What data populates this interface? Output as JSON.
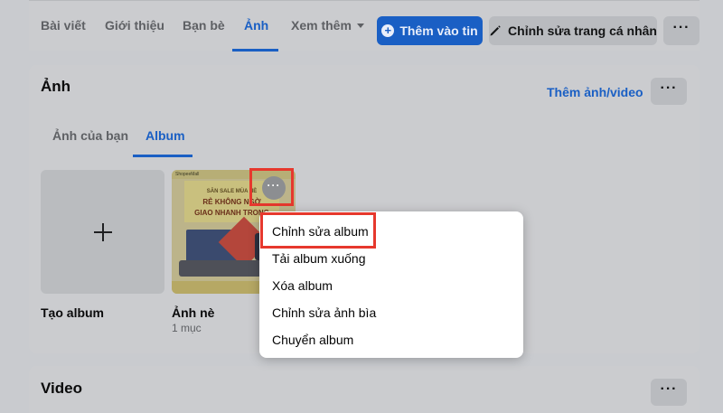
{
  "nav": {
    "tabs": [
      "Bài viết",
      "Giới thiệu",
      "Bạn bè",
      "Ảnh",
      "Xem thêm"
    ],
    "active_tab": "Ảnh",
    "add_story": "Thêm vào tin",
    "edit_profile": "Chỉnh sửa trang cá nhân",
    "more": "···"
  },
  "photos": {
    "title": "Ảnh",
    "add_link": "Thêm ảnh/video",
    "more": "···",
    "subtabs": [
      "Ảnh của bạn",
      "Album"
    ],
    "active_subtab": "Album",
    "create_album_label": "Tạo album",
    "album_name": "Ảnh nè",
    "album_count": "1 mục",
    "album_more": "···",
    "cover_text": {
      "logo": "ShopeeMall",
      "line1": "SĂN SALE MÙA HÈ",
      "line2": "RẺ KHÔNG NGỜ",
      "line3": "GIAO NHANH TRONG"
    }
  },
  "menu": {
    "items": [
      "Chỉnh sửa album",
      "Tải album xuống",
      "Xóa album",
      "Chỉnh sửa ảnh bìa",
      "Chuyển album"
    ]
  },
  "video": {
    "title": "Video",
    "more": "···"
  },
  "colors": {
    "accent": "#1a5fc4",
    "highlight": "#e6382d",
    "overlay_background": "#c9cbcf"
  }
}
